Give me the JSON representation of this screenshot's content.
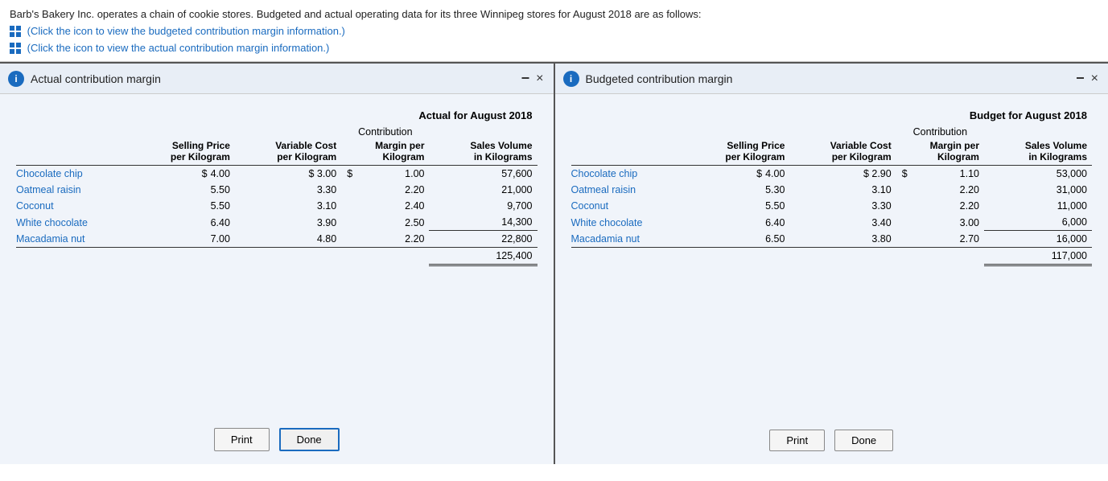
{
  "top": {
    "description": "Barb's Bakery Inc. operates a chain of cookie stores. Budgeted and actual operating data for its three Winnipeg stores for August 2018 are as follows:",
    "link1": "(Click the icon to view the budgeted contribution margin information.)",
    "link2": "(Click the icon to view the actual contribution margin information.)"
  },
  "actual_panel": {
    "title": "Actual contribution margin",
    "table_heading": "Actual for August 2018",
    "col_contribution": "Contribution",
    "col_selling": "Selling Price",
    "col_selling2": "per Kilogram",
    "col_variable": "Variable Cost",
    "col_variable2": "per Kilogram",
    "col_margin": "Margin per",
    "col_margin2": "Kilogram",
    "col_sales": "Sales Volume",
    "col_sales2": "in Kilograms",
    "rows": [
      {
        "label": "Chocolate chip",
        "selling": "4.00",
        "variable": "3.00",
        "margin": "1.00",
        "sales": "57,600",
        "dollar_selling": "$",
        "dollar_variable": "$",
        "dollar_margin": "$"
      },
      {
        "label": "Oatmeal raisin",
        "selling": "5.50",
        "variable": "3.30",
        "margin": "2.20",
        "sales": "21,000",
        "dollar_selling": "",
        "dollar_variable": "",
        "dollar_margin": ""
      },
      {
        "label": "Coconut",
        "selling": "5.50",
        "variable": "3.10",
        "margin": "2.40",
        "sales": "9,700",
        "dollar_selling": "",
        "dollar_variable": "",
        "dollar_margin": ""
      },
      {
        "label": "White chocolate",
        "selling": "6.40",
        "variable": "3.90",
        "margin": "2.50",
        "sales": "14,300",
        "dollar_selling": "",
        "dollar_variable": "",
        "dollar_margin": ""
      },
      {
        "label": "Macadamia nut",
        "selling": "7.00",
        "variable": "4.80",
        "margin": "2.20",
        "sales": "22,800",
        "dollar_selling": "",
        "dollar_variable": "",
        "dollar_margin": ""
      }
    ],
    "total": "125,400",
    "print_label": "Print",
    "done_label": "Done"
  },
  "budgeted_panel": {
    "title": "Budgeted contribution margin",
    "table_heading": "Budget for August 2018",
    "col_contribution": "Contribution",
    "col_selling": "Selling Price",
    "col_selling2": "per Kilogram",
    "col_variable": "Variable Cost",
    "col_variable2": "per Kilogram",
    "col_margin": "Margin per",
    "col_margin2": "Kilogram",
    "col_sales": "Sales Volume",
    "col_sales2": "in Kilograms",
    "rows": [
      {
        "label": "Chocolate chip",
        "selling": "4.00",
        "variable": "2.90",
        "margin": "1.10",
        "sales": "53,000",
        "dollar_selling": "$",
        "dollar_variable": "$",
        "dollar_margin": "$"
      },
      {
        "label": "Oatmeal raisin",
        "selling": "5.30",
        "variable": "3.10",
        "margin": "2.20",
        "sales": "31,000",
        "dollar_selling": "",
        "dollar_variable": "",
        "dollar_margin": ""
      },
      {
        "label": "Coconut",
        "selling": "5.50",
        "variable": "3.30",
        "margin": "2.20",
        "sales": "11,000",
        "dollar_selling": "",
        "dollar_variable": "",
        "dollar_margin": ""
      },
      {
        "label": "White chocolate",
        "selling": "6.40",
        "variable": "3.40",
        "margin": "3.00",
        "sales": "6,000",
        "dollar_selling": "",
        "dollar_variable": "",
        "dollar_margin": ""
      },
      {
        "label": "Macadamia nut",
        "selling": "6.50",
        "variable": "3.80",
        "margin": "2.70",
        "sales": "16,000",
        "dollar_selling": "",
        "dollar_variable": "",
        "dollar_margin": ""
      }
    ],
    "total": "117,000",
    "print_label": "Print",
    "done_label": "Done"
  },
  "icons": {
    "info": "i",
    "minimize": "−",
    "close": "×"
  }
}
